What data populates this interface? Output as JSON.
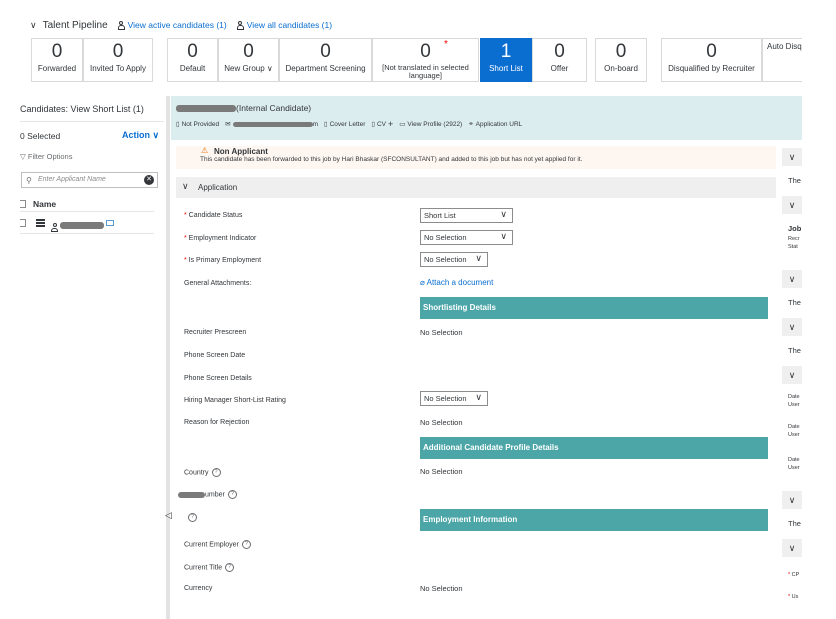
{
  "pipeline": {
    "chevron": "∨",
    "title": "Talent Pipeline",
    "view_active": "View active candidates (1)",
    "view_all": "View all candidates (1)",
    "stages": [
      {
        "count": "0",
        "label": "Forwarded"
      },
      {
        "count": "0",
        "label": "Invited To Apply"
      },
      {
        "count": "0",
        "label": "Default"
      },
      {
        "count": "0",
        "label": "New Group ∨"
      },
      {
        "count": "0",
        "label": "Department Screening"
      },
      {
        "count": "0",
        "label": "[Not translated in selected language]",
        "star": "*"
      },
      {
        "count": "1",
        "label": "Short List"
      },
      {
        "count": "0",
        "label": "Offer"
      },
      {
        "count": "0",
        "label": "On-board"
      },
      {
        "count": "0",
        "label": "Disqualified by Recruiter"
      },
      {
        "count": "",
        "label": "Auto Disqu"
      }
    ]
  },
  "left": {
    "title": "Candidates: View Short List (1)",
    "selected": "0 Selected",
    "action": "Action ∨",
    "filter": "Filter Options",
    "search_placeholder": "Enter Applicant Name",
    "col_name": "Name"
  },
  "candidate": {
    "name_suffix": "(Internal Candidate)",
    "not_provided": "Not Provided",
    "email_tail": "m",
    "cover_letter": "Cover Letter",
    "cv": "CV",
    "view_profile": "View Profile (2922)",
    "app_url": "Application URL"
  },
  "warning": {
    "title": "Non Applicant",
    "text": "This candidate has been forwarded to this job by Hari Bhaskar (SFCONSULTANT) and added to this job but has not yet applied for it."
  },
  "section": {
    "title": "Application"
  },
  "form": {
    "candidate_status": "Candidate Status",
    "candidate_status_val": "Short List",
    "employment_indicator": "Employment Indicator",
    "employment_indicator_val": "No Selection",
    "primary_employment": "Is Primary Employment",
    "primary_employment_val": "No Selection",
    "general_attachments": "General Attachments:",
    "attach_doc": "Attach a document",
    "shortlisting": "Shortlisting Details",
    "recruiter_prescreen": "Recruiter Prescreen",
    "recruiter_prescreen_val": "No Selection",
    "phone_screen_date": "Phone Screen Date",
    "phone_screen_details": "Phone Screen Details",
    "hm_rating": "Hiring Manager Short-List Rating",
    "hm_rating_val": "No Selection",
    "reason_rejection": "Reason for Rejection",
    "reason_rejection_val": "No Selection",
    "additional_profile": "Additional Candidate Profile Details",
    "country": "Country",
    "country_val": "No Selection",
    "number_label": "umber",
    "employment_info": "Employment Information",
    "current_employer": "Current Employer",
    "current_title": "Current Title",
    "currency": "Currency",
    "currency_val": "No Selection"
  },
  "right": {
    "the": "The",
    "job": "Job",
    "recr": "Recr",
    "stat": "Stat",
    "date": "Date",
    "user": "User",
    "cp": "CP",
    "us": "Us"
  }
}
